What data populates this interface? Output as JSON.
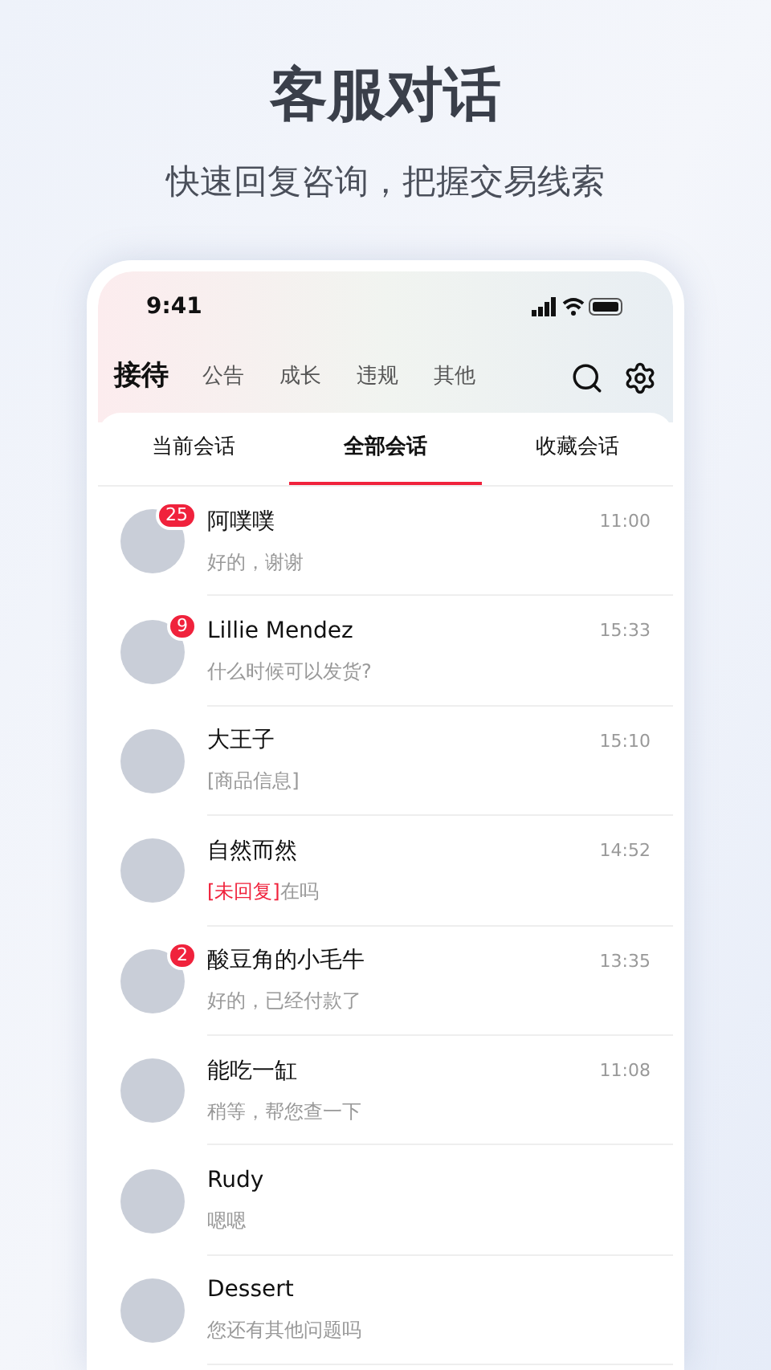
{
  "headline": "客服对话",
  "subtitle": "快速回复咨询，把握交易线索",
  "status_bar": {
    "time": "9:41"
  },
  "header": {
    "title": "接待",
    "nav": [
      "公告",
      "成长",
      "违规",
      "其他"
    ]
  },
  "tabs": [
    {
      "label": "当前会话",
      "selected": false
    },
    {
      "label": "全部会话",
      "selected": true
    },
    {
      "label": "收藏会话",
      "selected": false
    }
  ],
  "conversations": [
    {
      "name": "阿噗噗",
      "time": "11:00",
      "preview": "好的，谢谢",
      "badge": "25"
    },
    {
      "name": "Lillie Mendez",
      "time": "15:33",
      "preview": "什么时候可以发货?",
      "badge": "9"
    },
    {
      "name": "大王子",
      "time": "15:10",
      "preview": "[商品信息]"
    },
    {
      "name": "自然而然",
      "time": "14:52",
      "tag": "[未回复]",
      "preview": "在吗"
    },
    {
      "name": "酸豆角的小毛牛",
      "time": "13:35",
      "preview": "好的，已经付款了",
      "badge": "2"
    },
    {
      "name": "能吃一缸",
      "time": "11:08",
      "preview": "稍等，帮您查一下"
    },
    {
      "name": "Rudy",
      "preview": "嗯嗯"
    },
    {
      "name": "Dessert",
      "preview": "您还有其他问题吗"
    }
  ]
}
